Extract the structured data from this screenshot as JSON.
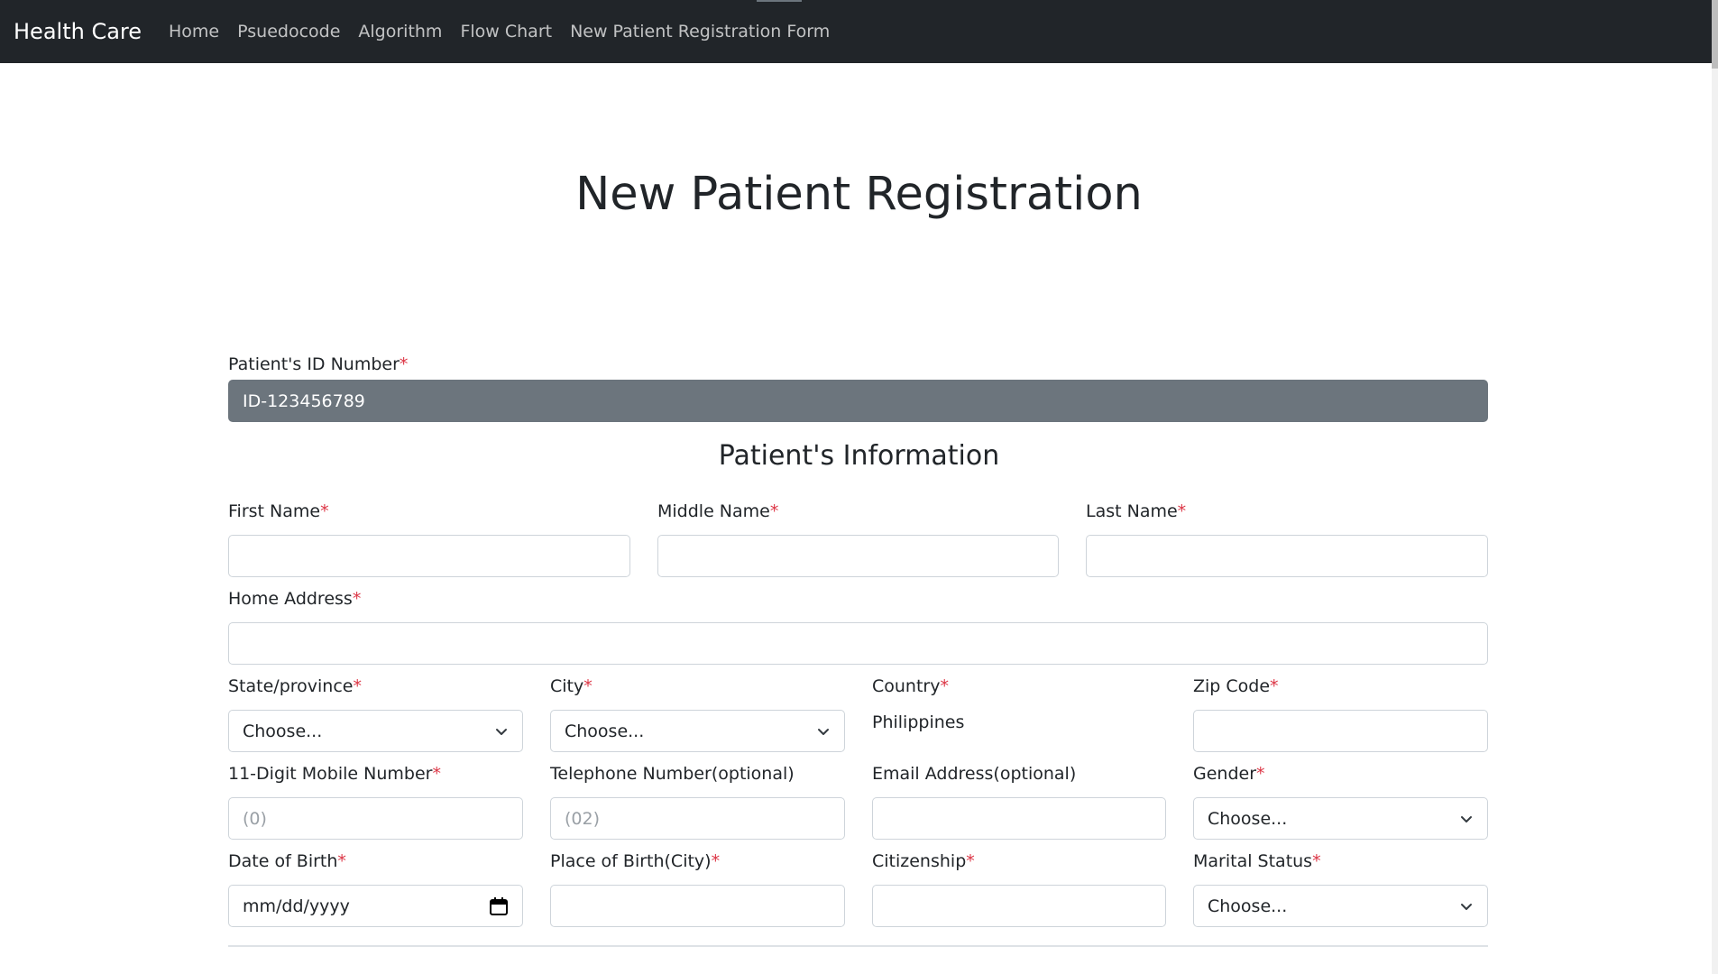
{
  "navbar": {
    "brand": "Health Care",
    "links": [
      "Home",
      "Psuedocode",
      "Algorithm",
      "Flow Chart",
      "New Patient Registration Form"
    ]
  },
  "page": {
    "title": "New Patient Registration"
  },
  "form": {
    "required_mark": "*",
    "patient_id": {
      "label": "Patient's ID Number",
      "value": "ID-123456789"
    },
    "section_title": "Patient's Information",
    "first_name": {
      "label": "First Name",
      "value": ""
    },
    "middle_name": {
      "label": "Middle Name",
      "value": ""
    },
    "last_name": {
      "label": "Last Name",
      "value": ""
    },
    "home_address": {
      "label": "Home Address",
      "value": ""
    },
    "state": {
      "label": "State/province",
      "selected": "Choose..."
    },
    "city": {
      "label": "City",
      "selected": "Choose..."
    },
    "country": {
      "label": "Country",
      "value": "Philippines"
    },
    "zip": {
      "label": "Zip Code",
      "value": ""
    },
    "mobile": {
      "label": "11-Digit Mobile Number",
      "placeholder": "(0)"
    },
    "telephone": {
      "label": "Telephone Number(optional)",
      "placeholder": "(02)"
    },
    "email": {
      "label": "Email Address(optional)",
      "value": ""
    },
    "gender": {
      "label": "Gender",
      "selected": "Choose..."
    },
    "dob": {
      "label": "Date of Birth",
      "placeholder": "mm/dd/yyyy"
    },
    "place_of_birth": {
      "label": "Place of Birth(City)",
      "value": ""
    },
    "citizenship": {
      "label": "Citizenship",
      "value": ""
    },
    "marital_status": {
      "label": "Marital Status",
      "selected": "Choose..."
    }
  },
  "icons": {
    "select_arrow": "chevron-down-icon",
    "date_picker": "calendar-icon"
  }
}
